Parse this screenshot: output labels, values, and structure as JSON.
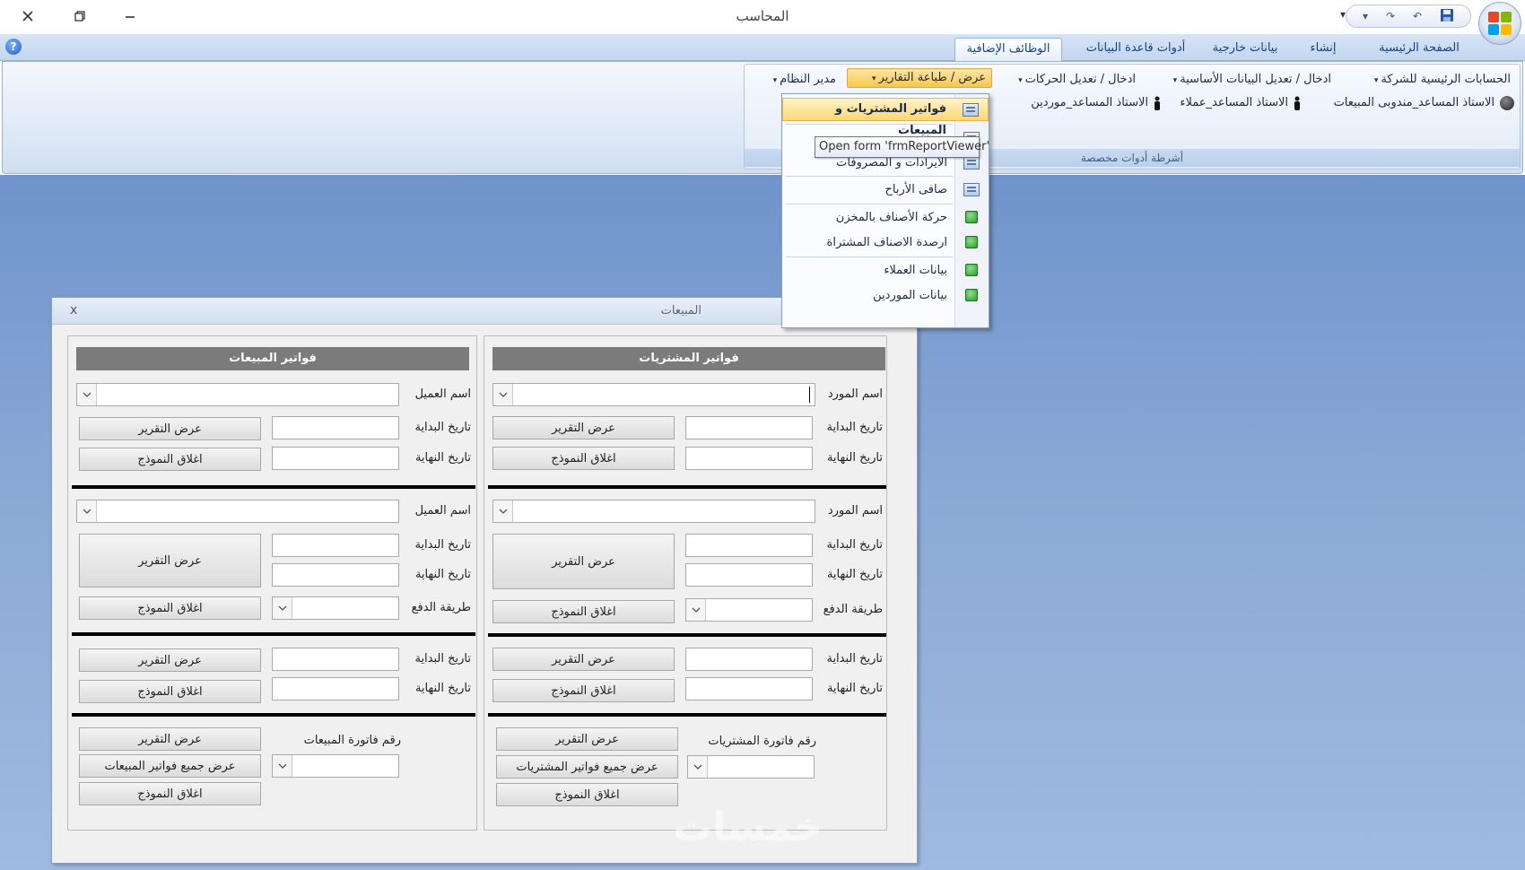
{
  "window": {
    "title": "المحاسب",
    "close": "✕",
    "restore": "❐",
    "minimize": "—",
    "qat_more": "▾"
  },
  "tabs": [
    "الصفحة الرئيسية",
    "إنشاء",
    "بيانات خارجية",
    "أدوات قاعدة البيانات",
    "الوظائف الإضافية"
  ],
  "ribbon": {
    "row1": [
      "الحسابات الرئيسية للشركة",
      "ادخال / تعديل البيانات الأساسية",
      "ادخال / تعديل الحركات",
      "عرض / طباعة التقارير",
      "مدير النظام"
    ],
    "row2": [
      "الاستاذ المساعد_مندوبى المبيعات",
      "الاستاذ المساعد_عملاء",
      "الاستاذ المساعد_موردين"
    ],
    "group_label": "أشرطة أدوات مخصصة"
  },
  "dropdown": {
    "items": [
      "فواتير المشتريات و المبيعات",
      "الايرادات و المصروفات",
      "صافى الأرباح",
      "حركة الأصناف بالمخزن",
      "ارصدة الاصناف المشتراة",
      "بيانات العملاء",
      "بيانات الموردين"
    ],
    "tooltip": "Open form 'frmReportViewer'"
  },
  "form": {
    "caption": "المبيعات",
    "close": "x",
    "purchases": {
      "header": "فواتير المشتريات",
      "party_label": "اسم المورد",
      "invoice_label": "رقم فاتورة المشتريات",
      "show_all": "عرض جميع فواتير المشتريات"
    },
    "sales": {
      "header": "فواتير المبيعات",
      "party_label": "اسم العميل",
      "invoice_label": "رقم فاتورة المبيعات",
      "show_all": "عرض جميع فواتير المبيعات"
    },
    "start_date": "تاريخ البداية",
    "end_date": "تاريخ النهاية",
    "payment_method": "طريقة الدفع",
    "show_report": "عرض التقرير",
    "close_form": "اغلاق النموذج"
  },
  "watermark": "خمسات",
  "colors": {
    "accent": "#15428b",
    "desktop": "#8aa9d6",
    "highlight": "#f9c54c",
    "group_header": "#7b7b7b"
  }
}
